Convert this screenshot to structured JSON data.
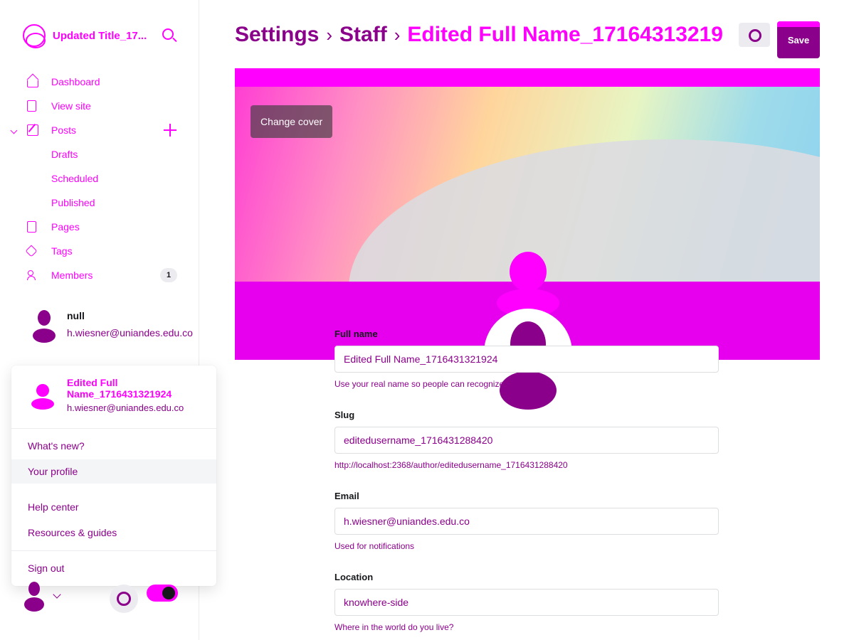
{
  "brand": {
    "title": "Updated Title_17...",
    "icon": "site-logo-icon",
    "search_icon": "search-icon"
  },
  "nav": {
    "items": [
      {
        "label": "Dashboard",
        "icon": "home-icon"
      },
      {
        "label": "View site",
        "icon": "view-site-icon"
      },
      {
        "label": "Posts",
        "icon": "edit-icon",
        "expanded": true
      },
      {
        "label": "Drafts"
      },
      {
        "label": "Scheduled"
      },
      {
        "label": "Published"
      },
      {
        "label": "Pages",
        "icon": "page-icon"
      },
      {
        "label": "Tags",
        "icon": "tag-icon"
      },
      {
        "label": "Members",
        "icon": "members-icon",
        "count": "1"
      }
    ]
  },
  "sidebar_user": {
    "name": "null",
    "email": "h.wiesner@uniandes.edu.co"
  },
  "popup": {
    "name": "Edited Full Name_1716431321924",
    "email": "h.wiesner@uniandes.edu.co",
    "items": [
      "What's new?",
      "Your profile",
      "Help center",
      "Resources & guides",
      "Sign out"
    ]
  },
  "breadcrumb": {
    "settings": "Settings",
    "staff": "Staff",
    "name": "Edited Full Name_17164313219"
  },
  "header": {
    "save_label": "Save",
    "settings_icon": "gear-icon"
  },
  "cover": {
    "change_label": "Change cover"
  },
  "form": {
    "full_name": {
      "label": "Full name",
      "value": "Edited Full Name_1716431321924",
      "hint": "Use your real name so people can recognize you"
    },
    "slug": {
      "label": "Slug",
      "value": "editedusername_1716431288420",
      "hint": "http://localhost:2368/author/editedusername_1716431288420"
    },
    "email": {
      "label": "Email",
      "value": "h.wiesner@uniandes.edu.co",
      "hint": "Used for notifications"
    },
    "location": {
      "label": "Location",
      "value": "knowhere-side",
      "hint": "Where in the world do you live?"
    }
  },
  "colors": {
    "accent": "#ff00ff",
    "accent_dark": "#8b008b"
  }
}
